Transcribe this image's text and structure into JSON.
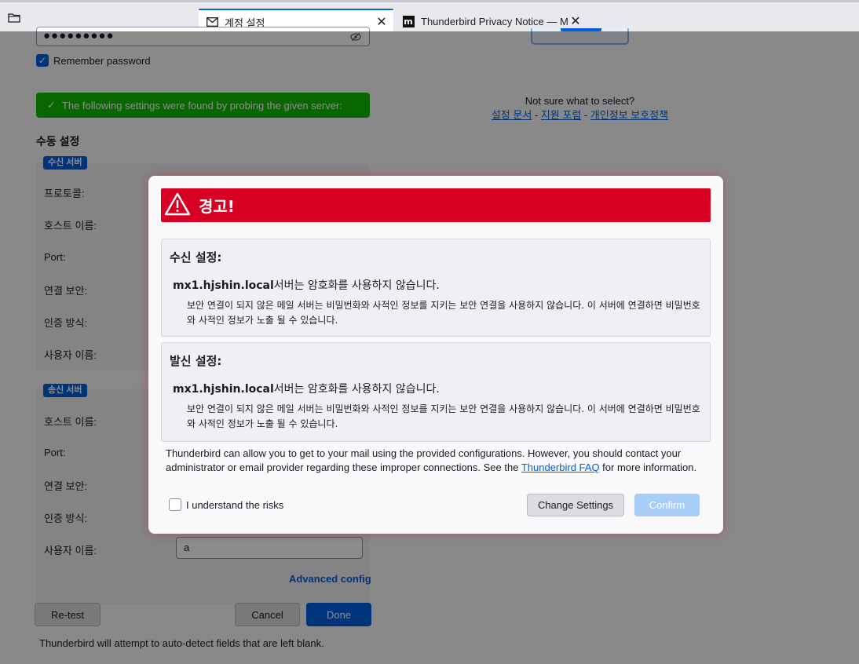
{
  "tabs": [
    {
      "label": "계정 설정",
      "icon": "envelope-icon",
      "active": true
    },
    {
      "label": "Thunderbird Privacy Notice — Mo",
      "icon": "mozilla-m-icon",
      "active": false
    }
  ],
  "background": {
    "password_masked": "●●●●●●●●●",
    "remember_password": "Remember password",
    "found_banner": "The following settings were found by probing the given server:",
    "manual_title": "수동 설정",
    "incoming": {
      "badge": "수신 서버",
      "labels": [
        "프로토콜:",
        "호스트 이름:",
        "Port:",
        "연결 보안:",
        "인증 방식:",
        "사용자 이름:"
      ]
    },
    "outgoing": {
      "badge": "송신 서버",
      "labels": [
        "호스트 이름:",
        "Port:",
        "연결 보안:",
        "인증 방식:",
        "사용자 이름:"
      ],
      "username_value": "a"
    },
    "advanced_config": "Advanced config",
    "retest": "Re-test",
    "cancel": "Cancel",
    "done": "Done",
    "footnote": "Thunderbird will attempt to auto-detect fields that are left blank.",
    "help": {
      "question": "Not sure what to select?",
      "links": [
        "설정 문서",
        "지원 포럼",
        "개인정보 보호정책"
      ],
      "separator": " - "
    }
  },
  "dialog": {
    "title": "경고!",
    "incoming": {
      "title": "수신 설정:",
      "host": "mx1.hjshin.local",
      "host_suffix": "서버는 암호화를 사용하지 않습니다.",
      "description": "보안 연결이 되지 않은 메일 서버는 비밀번화와 사적인 정보를 지키는 보안 연결을 사용하지 않습니다. 이 서버에 연결하면 비밀번호와 사적인 정보가 노출 될 수 있습니다."
    },
    "outgoing": {
      "title": "발신 설정:",
      "host": "mx1.hjshin.local",
      "host_suffix": "서버는 암호화를 사용하지 않습니다.",
      "description": "보안 연결이 되지 않은 메일 서버는 비밀번화와 사적인 정보를 지키는 보안 연결을 사용하지 않습니다. 이 서버에 연결하면 비밀번호와 사적인 정보가 노출 될 수 있습니다."
    },
    "info_before": "Thunderbird can allow you to get to your mail using the provided configurations. However, you should contact your administrator or email provider regarding these improper connections. See the ",
    "info_link": "Thunderbird FAQ",
    "info_after": " for more information.",
    "understand": "I understand the risks",
    "change_settings": "Change Settings",
    "confirm": "Confirm"
  },
  "colors": {
    "accent": "#0060df",
    "warning": "#d70022",
    "success": "#12bc00"
  }
}
